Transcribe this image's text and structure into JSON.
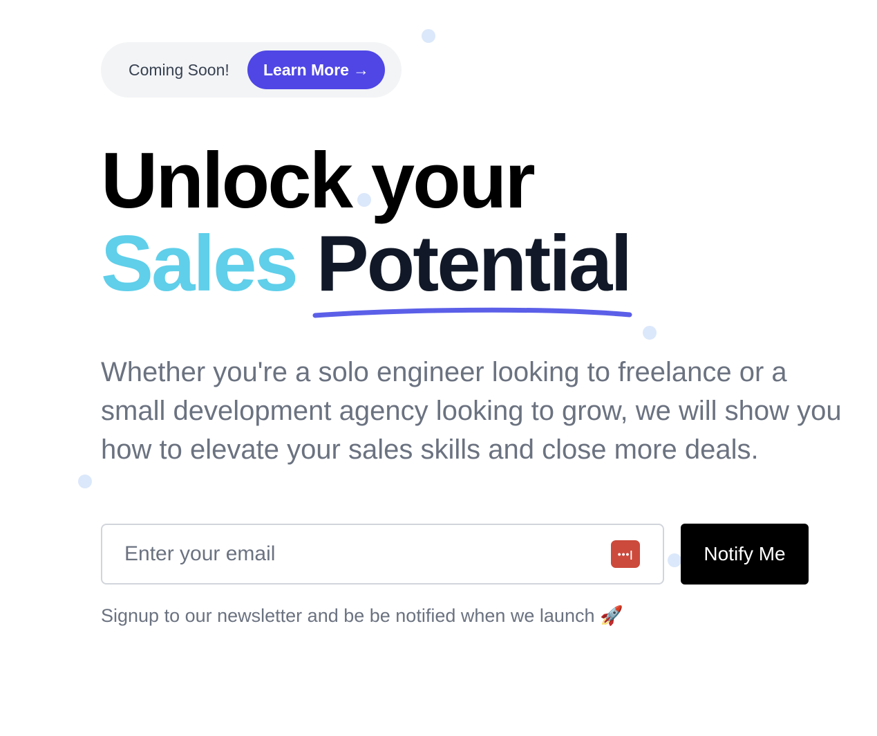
{
  "badge": {
    "text": "Coming Soon!",
    "button_label": "Learn More",
    "button_icon": "arrow-right-icon",
    "button_color": "#4f46e5"
  },
  "headline": {
    "line1": "Unlock your",
    "highlight": "Sales",
    "emphasis": "Potential",
    "highlight_color": "#5fcfea",
    "underline_color": "#5b5fe8"
  },
  "description": "Whether you're a solo engineer looking to freelance or a small development agency looking to grow, we will show you how to elevate your sales skills and close more deals.",
  "signup": {
    "email_placeholder": "Enter your email",
    "email_value": "",
    "autofill_icon": "password-manager-icon",
    "submit_label": "Notify Me",
    "note": "Signup to our newsletter and be be notified when we launch 🚀"
  }
}
